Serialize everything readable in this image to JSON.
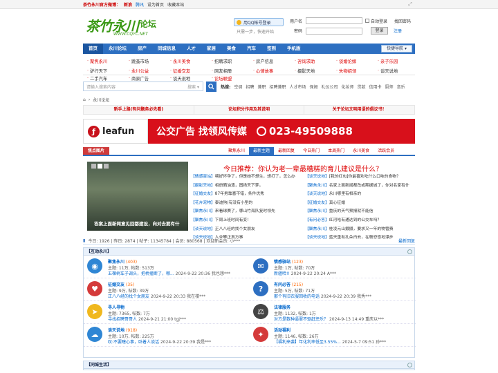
{
  "topbar": {
    "label": "茶竹永川官方微博：",
    "weibo_sina": "新浪",
    "weibo_tencent": "腾讯",
    "set_home": "设为首页",
    "bookmark": "收藏本站"
  },
  "logo": {
    "main": "茶竹永川",
    "suffix": "论坛",
    "url_text": "WWW.CQYC.NET"
  },
  "qq": {
    "button": "用QQ帐号登录",
    "sub": "只需一步，快速开始"
  },
  "login": {
    "user_label": "用户名",
    "pass_label": "密码",
    "auto_login": "自动登录",
    "forgot": "找回密码",
    "submit": "登录",
    "register": "注册"
  },
  "nav": {
    "items": [
      "首页",
      "永川论坛",
      "房产",
      "同城信息",
      "人才",
      "家居",
      "美食",
      "汽车",
      "签到",
      "手机版"
    ],
    "quick": "快捷导航"
  },
  "sublinks": [
    "聚焦永川",
    "跳蚤市场",
    "永川美食",
    "招聘求职",
    "房产信息",
    "咨询求助",
    "谈婚论嫁",
    "亲子乐园",
    "驴行天下",
    "永川公益",
    "征婚交友",
    "网友相册",
    "心情故事",
    "摄影天地",
    "失物招领",
    "谈天说地",
    "二手汽车",
    "商家广告",
    "谈天说地",
    "论坛联盟"
  ],
  "search": {
    "placeholder": "请输入搜索内容",
    "type": "搜索",
    "hot_label": "热搜:",
    "hot": [
      "空调",
      "招聘",
      "兼职",
      "招聘兼职",
      "人才市场",
      "保姆",
      "礼仪公司",
      "化妆师",
      "贷款",
      "信用卡",
      "厨师",
      "音乐"
    ]
  },
  "breadcrumb": {
    "home": "⌂",
    "section": "永川论坛"
  },
  "announce": [
    "新手上路(有问题务必先看)",
    "论坛积分作用及其说明",
    "关于论坛文明用语的倡议书！"
  ],
  "banner": {
    "brand": "leafun",
    "text": "公交广告 找领风传媒",
    "phone": "023-49509888"
  },
  "focus": {
    "tab": "焦点图片",
    "tabs": [
      "聚焦永川",
      "最新主题",
      "最新回复",
      "今日热门",
      "本周热门",
      "永川美食",
      "活跃会员"
    ],
    "caption": "答案上面新闻意见回都建设，向对去要有什",
    "headline": "今日推荐：你认为老一辈最糟糕的育儿建议是什么？",
    "items": [
      {
        "tag": "【情感驿站】",
        "text": "喂好怀孕了，但是她不想生，想打了，怎么办"
      },
      {
        "tag": "【谈天说地】",
        "text": "[我的红包]你最喜欢吃什么口味的食物？"
      },
      {
        "tag": "【摄影天地】",
        "text": "相册晒油渣，图扬天下梦。"
      },
      {
        "tag": "【聚焦永川】",
        "text": "名家上面新闻都改或期据城了，你对名家有什"
      },
      {
        "tag": "【征婚交友】",
        "text": "87年男靠喜不错，条件优秀"
      },
      {
        "tag": "【谈天说地】",
        "text": "永川哪里有相亲的"
      },
      {
        "tag": "【花卉宠物】",
        "text": "泰迪狗(有没有小型的"
      },
      {
        "tag": "【征婚交友】",
        "text": "真心征婚"
      },
      {
        "tag": "【聚焦永川】",
        "text": "来看球赛了，哪山竹海队复时领先"
      },
      {
        "tag": "【聚焦永川】",
        "text": "重庆的天气预报就不能信"
      },
      {
        "tag": "【聚焦永川】",
        "text": "下周上班时间有变！"
      },
      {
        "tag": "【有问必答】",
        "text": "红河哈有通达到的公交车吗？"
      },
      {
        "tag": "【谈天说地】",
        "text": "正八八经的找个女朋友"
      },
      {
        "tag": "【聚焦永川】",
        "text": "桂凌元山摄摄，要求又一年的物管费"
      },
      {
        "tag": "【谈天说地】",
        "text": "人业攀正真万事"
      },
      {
        "tag": "【谈天说地】",
        "text": "蓝天重有孔朵白云，在赣恐悠地漂步"
      }
    ]
  },
  "stats": {
    "text": "今日: 1926 | 昨日: 2874 | 帖子: 11345784 | 会员: 880568 | 欢迎新会员: 小***",
    "latest": "最新回复"
  },
  "section1": {
    "title": "【互动永川】"
  },
  "forums": [
    {
      "name": "聚焦永川",
      "count": "(403)",
      "stats": "主题: 11万, 帖数: 513万",
      "last_link": "五棵树车子调头，把桥撞断了，哪...",
      "last_time": "2024-9-22 20:36",
      "last_user": "我也想***",
      "color": "#2f86d4",
      "glyph": "◉"
    },
    {
      "name": "情感驿站",
      "count": "(123)",
      "stats": "主题: 1万, 帖数: 70万",
      "last_link": "新疆哈!!",
      "last_time": "2024-9-22 20:24",
      "last_user": "A***",
      "color": "#2d6fc1",
      "glyph": "✉"
    },
    {
      "name": "征婚交友",
      "count": "(35)",
      "stats": "主题: 9万, 帖数: 39万",
      "last_link": "正八八经的找个女朋友",
      "last_time": "2024-9-22 20:33",
      "last_user": "我在楼***",
      "color": "#d43a3a",
      "glyph": "♥"
    },
    {
      "name": "有问必答",
      "count": "(215)",
      "stats": "主题: 5万, 帖数: 71万",
      "last_link": "那个有旧衣服回收的电话",
      "last_time": "2024-9-22 20:39",
      "last_user": "我秀***",
      "color": "#2d6fc1",
      "glyph": "?"
    },
    {
      "name": "寻人寻物",
      "count": "",
      "stats": "主题: 7365, 帖数: 7万",
      "last_link": "寻找招聘哥哥人",
      "last_time": "2024-9-21 21:00",
      "last_user": "tgj***",
      "color": "#f0b81e",
      "glyph": "➤"
    },
    {
      "name": "法律服务",
      "count": "",
      "stats": "主题: 1132, 帖数: 1万",
      "last_link": "对方是数种逼罪不驱赶惩乐？",
      "last_time": "2024-9-13 14:49",
      "last_user": "重庆以***",
      "color": "#444444",
      "glyph": "⚖"
    },
    {
      "name": "谈天说地",
      "count": "(918)",
      "stats": "主题: 10万, 帖数: 225万",
      "last_link": "叹:不要瞎心事，卧着人谈话",
      "last_time": "2024-9-22 20:39",
      "last_user": "我是***",
      "color": "#2f86d4",
      "glyph": "☁"
    },
    {
      "name": "活动福利",
      "count": "",
      "stats": "主题: 1146, 帖数: 26万",
      "last_link": "【福利来袭】年化利率低至3.55%...",
      "last_time": "2024-5-7 09:51",
      "last_user": "孙***",
      "color": "#d43a3a",
      "glyph": "✦"
    }
  ],
  "section2": {
    "title": "【同城生活】"
  }
}
